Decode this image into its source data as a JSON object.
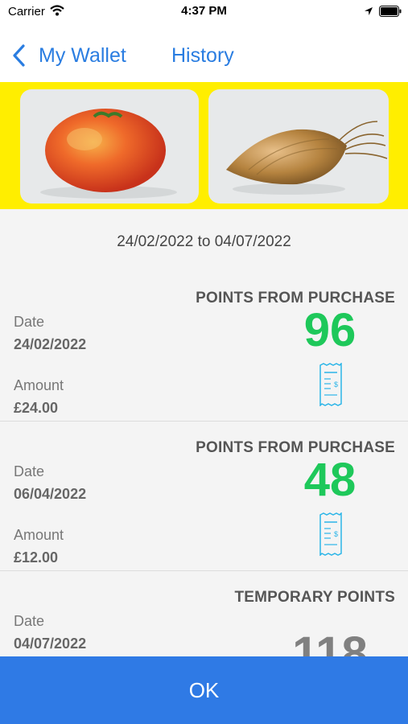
{
  "status_bar": {
    "carrier": "Carrier",
    "time": "4:37 PM"
  },
  "nav": {
    "back_label": "My Wallet",
    "history_label": "History"
  },
  "banner": {
    "left_image": "tomato",
    "right_image": "onion",
    "background": "#ffee00"
  },
  "date_range": "24/02/2022 to 04/07/2022",
  "entries": [
    {
      "type": "POINTS FROM PURCHASE",
      "date_label": "Date",
      "date": "24/02/2022",
      "amount_label": "Amount",
      "amount": "£24.00",
      "points": "96",
      "points_color": "#1ec85a",
      "icon": "receipt-icon"
    },
    {
      "type": "POINTS FROM PURCHASE",
      "date_label": "Date",
      "date": "06/04/2022",
      "amount_label": "Amount",
      "amount": "£12.00",
      "points": "48",
      "points_color": "#1ec85a",
      "icon": "receipt-icon"
    },
    {
      "type": "TEMPORARY POINTS",
      "date_label": "Date",
      "date": "04/07/2022",
      "points": "118",
      "points_color": "#808080"
    }
  ],
  "ok_button": {
    "label": "OK",
    "color": "#2f7ae5"
  },
  "colors": {
    "accent": "#2a7de1",
    "points_green": "#1ec85a"
  }
}
